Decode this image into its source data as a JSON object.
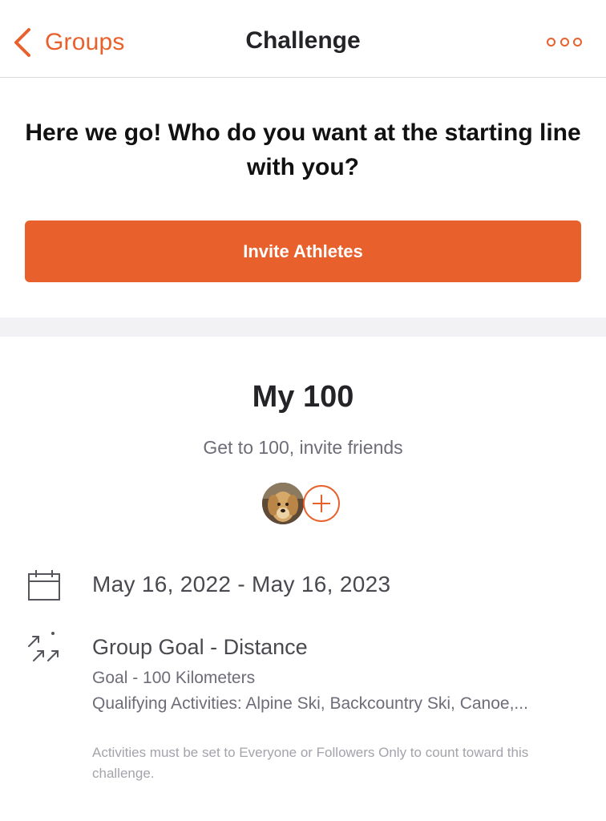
{
  "nav": {
    "back_label": "Groups",
    "title": "Challenge",
    "more_icon": "more-horizontal-icon"
  },
  "invite": {
    "prompt": "Here we go! Who do you want at the starting line with you?",
    "button_label": "Invite Athletes"
  },
  "challenge": {
    "title": "My 100",
    "description": "Get to 100, invite friends",
    "dates": "May 16, 2022 - May 16, 2023",
    "goal_title": "Group Goal - Distance",
    "goal_detail": "Goal - 100 Kilometers",
    "qualifying": "Qualifying Activities: Alpine Ski, Backcountry Ski, Canoe,...",
    "note": "Activities must be set to Everyone or Followers Only to count toward this challenge."
  },
  "colors": {
    "accent": "#e8602c",
    "text_dark": "#242428",
    "text_secondary": "#6d6d78",
    "text_muted": "#a3a3ab",
    "band": "#f2f2f4"
  }
}
